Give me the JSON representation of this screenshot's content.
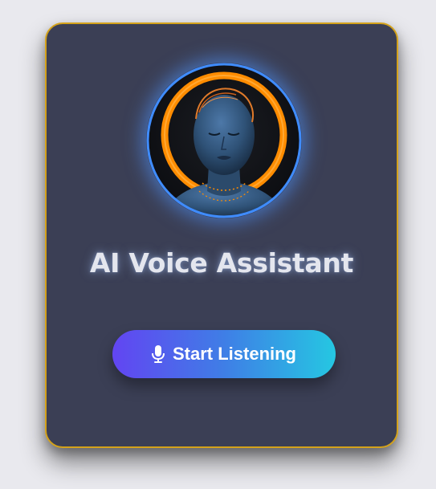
{
  "card": {
    "title": "AI Voice Assistant",
    "accent_border": "#d4a21b",
    "background": "#3b3f55"
  },
  "avatar": {
    "icon": "ai-face-avatar",
    "ring_color": "#ff8c00",
    "glow_color": "#3f8cff"
  },
  "button": {
    "label": "Start Listening",
    "icon": "microphone-icon",
    "gradient": [
      "#6245f2",
      "#25c7e2"
    ]
  }
}
